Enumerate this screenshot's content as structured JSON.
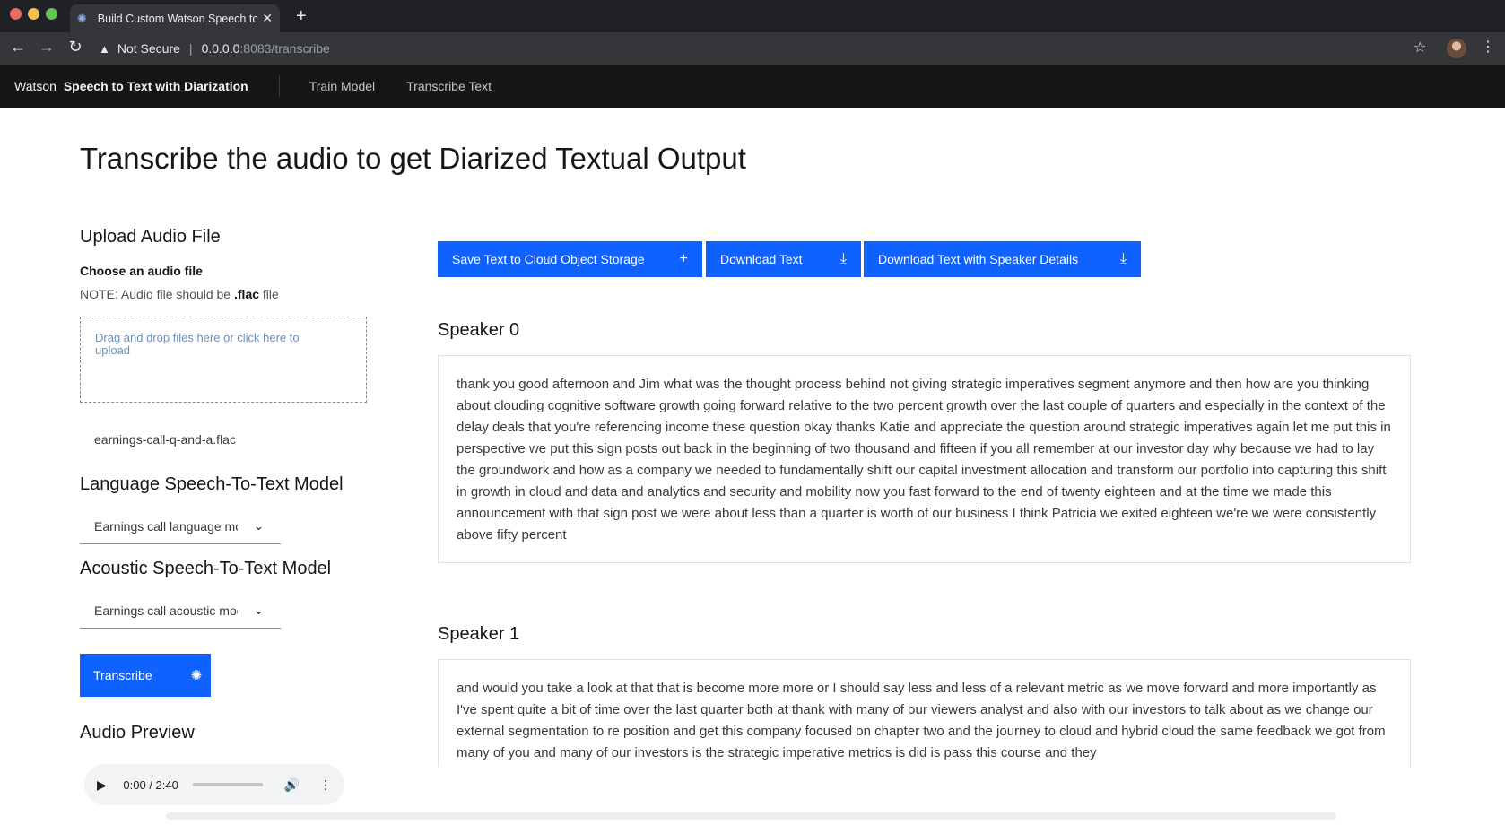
{
  "browser": {
    "tab_title": "Build Custom Watson Speech to Text",
    "security_label": "Not Secure",
    "url_host": "0.0.0.0",
    "url_rest": ":8083/transcribe"
  },
  "header": {
    "brand_prefix": "Watson",
    "brand_name": "Speech to Text with Diarization",
    "nav": [
      {
        "label": "Train Model"
      },
      {
        "label": "Transcribe Text"
      }
    ]
  },
  "main": {
    "title": "Transcribe the audio to get Diarized Textual Output",
    "upload": {
      "heading": "Upload Audio File",
      "label": "Choose an audio file",
      "note_prefix": "NOTE: Audio file should be ",
      "note_ext": ".flac",
      "note_suffix": " file",
      "dropzone_text": "Drag and drop files here or click here to upload",
      "file_name": "earnings-call-q-and-a.flac"
    },
    "language_model": {
      "heading": "Language Speech-To-Text Model",
      "selected": "Earnings call language model"
    },
    "acoustic_model": {
      "heading": "Acoustic Speech-To-Text Model",
      "selected": "Earnings call acoustic model"
    },
    "transcribe_button": "Transcribe",
    "audio": {
      "heading": "Audio Preview",
      "time": "0:00 / 2:40",
      "progress": 0
    },
    "actions": {
      "save_label": "Save Text to Cloud Object Storage",
      "download_label": "Download Text",
      "download_speaker_label": "Download Text with Speaker Details"
    },
    "speakers": [
      {
        "name": "Speaker 0",
        "text": "thank you good afternoon and Jim what was the thought process behind not giving strategic imperatives segment anymore and then how are you thinking about clouding cognitive software growth going forward relative to the two percent growth over the last couple of quarters and especially in the context of the delay deals that you're referencing income these question okay thanks Katie and appreciate the question around strategic imperatives again let me put this in perspective we put this sign posts out back in the beginning of two thousand and fifteen if you all remember at our investor day why because we had to lay the groundwork and how as a company we needed to fundamentally shift our capital investment allocation and transform our portfolio into capturing this shift in growth in cloud and data and analytics and security and mobility now you fast forward to the end of twenty eighteen and at the time we made this announcement with that sign post we were about less than a quarter is worth of our business I think Patricia we exited eighteen we're we were consistently above fifty percent"
      },
      {
        "name": "Speaker 1",
        "text": "and would you take a look at that that is become more more or I should say less and less of a relevant metric as we move forward and more importantly as I've spent quite a bit of time over the last quarter both at thank with many of our viewers analyst and also with our investors to talk about as we change our external segmentation to re position and get this company focused on chapter two and the journey to cloud and hybrid cloud the same feedback we got from many of you and many of our investors is the strategic imperative metrics is did is pass this course and they"
      }
    ]
  },
  "colors": {
    "primary": "#0f62fe",
    "header_bg": "#161616",
    "text": "#161616"
  }
}
